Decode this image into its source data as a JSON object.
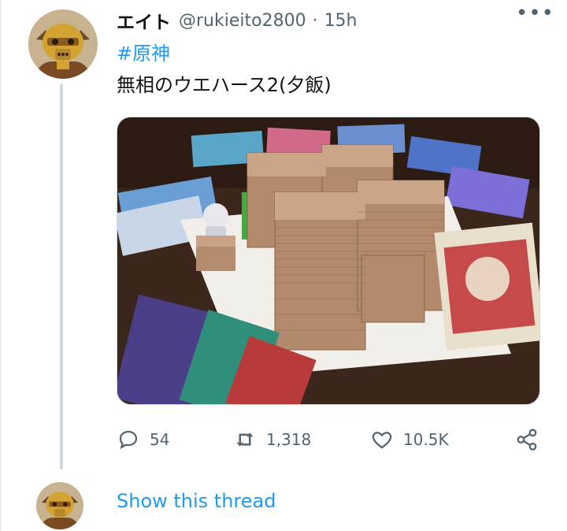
{
  "tweet": {
    "author_name": "エイト",
    "author_handle": "@rukieito2800",
    "separator": "·",
    "timestamp": "15h",
    "hashtag": "#原神",
    "text": "無相のウエハース2(夕飯)",
    "media_alt": "wafer cookies stacked on a table with trading cards",
    "actions": {
      "reply_count": "54",
      "retweet_count": "1,318",
      "like_count": "10.5K"
    },
    "more_icon": "more-horizontal-icon"
  },
  "thread": {
    "show_thread_label": "Show this thread"
  },
  "colors": {
    "accent": "#1d9bf0",
    "text_primary": "#0f1419",
    "text_secondary": "#536471",
    "thread_line": "#cfd9de"
  }
}
